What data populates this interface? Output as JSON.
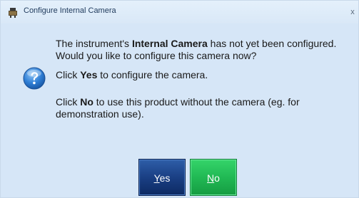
{
  "window": {
    "title": "Configure Internal Camera",
    "close_label": "x"
  },
  "message": {
    "line1_pre": "The instrument's ",
    "line1_bold": "Internal Camera",
    "line1_post": " has not yet been configured. Would you like to configure this camera now?",
    "line2_pre": "Click ",
    "line2_bold": "Yes",
    "line2_post": " to configure the camera.",
    "line3_pre": "Click ",
    "line3_bold": "No",
    "line3_post": " to use this product without the camera (eg. for demonstration use)."
  },
  "buttons": {
    "yes_mnemonic": "Y",
    "yes_rest": "es",
    "no_mnemonic": "N",
    "no_rest": "o"
  },
  "icons": {
    "title": "camera-device-icon",
    "dialog": "question-mark-icon"
  },
  "colors": {
    "dialog_bg": "#d6e6f7",
    "yes_button": "#1a3f84",
    "no_button": "#21b954"
  }
}
